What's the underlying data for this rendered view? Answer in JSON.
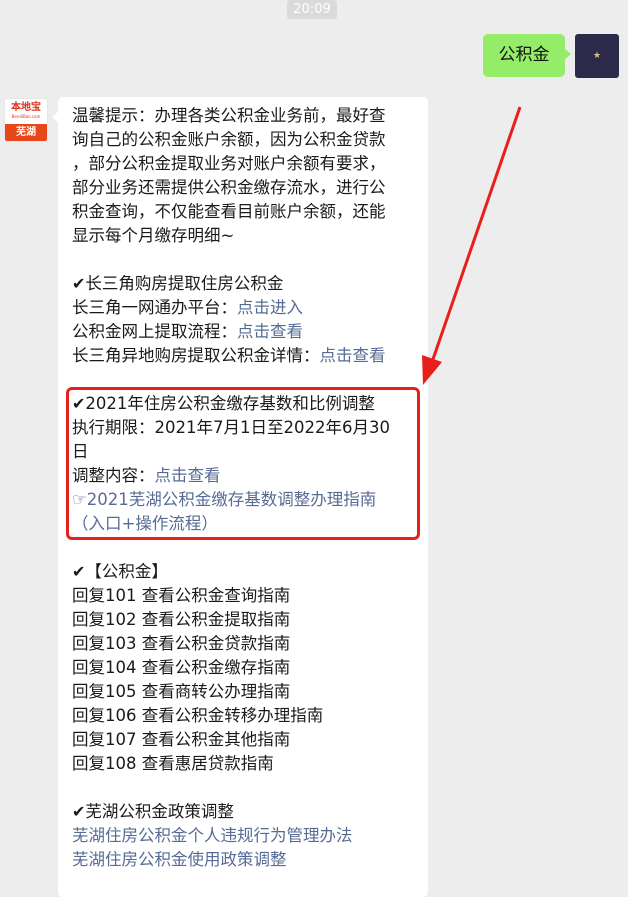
{
  "timestamp": "20:09",
  "user_message": "公积金",
  "bot_avatar": {
    "brand": "本地宝",
    "url": "BendiBao.com",
    "city": "芜湖"
  },
  "reply": {
    "intro_lines": [
      "温馨提示：办理各类公积金业务前，最好查",
      "询自己的公积金账户余额，因为公积金贷款",
      "，部分公积金提取业务对账户余额有要求，",
      "部分业务还需提供公积金缴存流水，进行公",
      "积金查询，不仅能查看目前账户余额，还能",
      "显示每个月缴存明细~"
    ],
    "section1": {
      "title": "长三角购房提取住房公积金",
      "rows": [
        {
          "label": "长三角一网通办平台：",
          "link": "点击进入"
        },
        {
          "label": "公积金网上提取流程：",
          "link": "点击查看"
        },
        {
          "label": "长三角异地购房提取公积金详情：",
          "link": "点击查看"
        }
      ]
    },
    "section2": {
      "title": "2021年住房公积金缴存基数和比例调整",
      "period_line1": "执行期限：2021年7月1日至2022年6月30",
      "period_line2": "日",
      "adjust_label": "调整内容：",
      "adjust_link": "点击查看",
      "guide_link_line1": "☞2021芜湖公积金缴存基数调整办理指南",
      "guide_link_line2": "（入口+操作流程）"
    },
    "section3": {
      "title": "【公积金】",
      "items": [
        "回复101  查看公积金查询指南",
        "回复102  查看公积金提取指南",
        "回复103  查看公积金贷款指南",
        "回复104  查看公积金缴存指南",
        "回复105  查看商转公办理指南",
        "回复106  查看公积金转移办理指南",
        "回复107  查看公积金其他指南",
        "回复108  查看惠居贷款指南"
      ]
    },
    "section4": {
      "title": "芜湖公积金政策调整",
      "links": [
        "芜湖住房公积金个人违规行为管理办法",
        "芜湖住房公积金使用政策调整"
      ]
    },
    "check_mark": "✔"
  },
  "colors": {
    "bubble_me": "#95ec69",
    "link": "#576b95",
    "highlight": "#e8201c"
  }
}
